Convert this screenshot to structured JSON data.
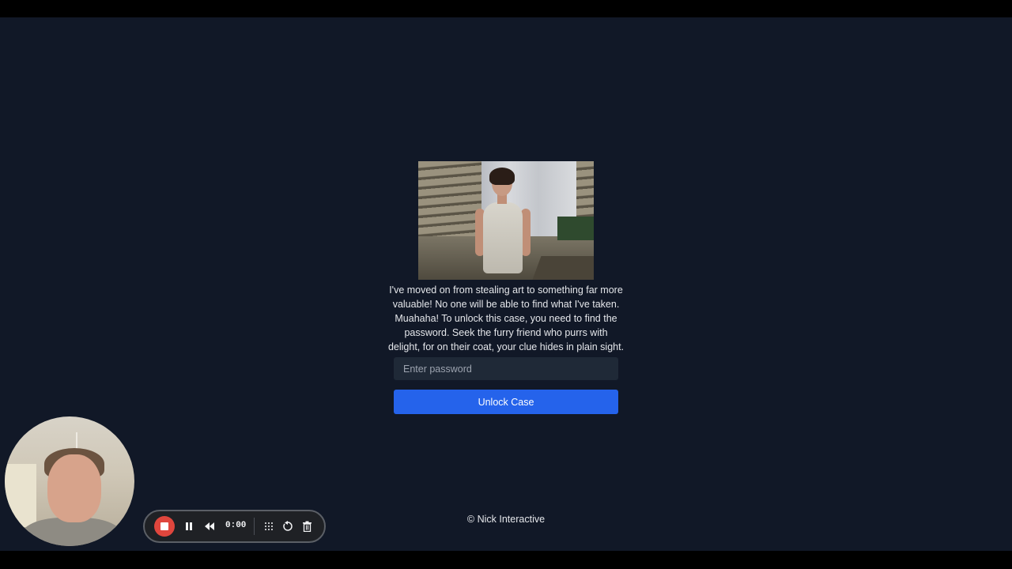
{
  "case": {
    "message": "I've moved on from stealing art to something far more valuable! No one will be able to find what I've taken. Muahaha! To unlock this case, you need to find the password. Seek the furry friend who purrs with delight, for on their coat, your clue hides in plain sight.",
    "password_placeholder": "Enter password",
    "unlock_label": "Unlock Case"
  },
  "footer": {
    "copyright": "© Nick Interactive"
  },
  "recorder": {
    "time": "0:00",
    "icons": [
      "stop-icon",
      "pause-icon",
      "rewind-icon",
      "grid-icon",
      "undo-icon",
      "trash-icon"
    ]
  },
  "colors": {
    "background": "#111827",
    "input_bg": "#1f2937",
    "button_bg": "#2563eb",
    "record_red": "#e0463d"
  }
}
